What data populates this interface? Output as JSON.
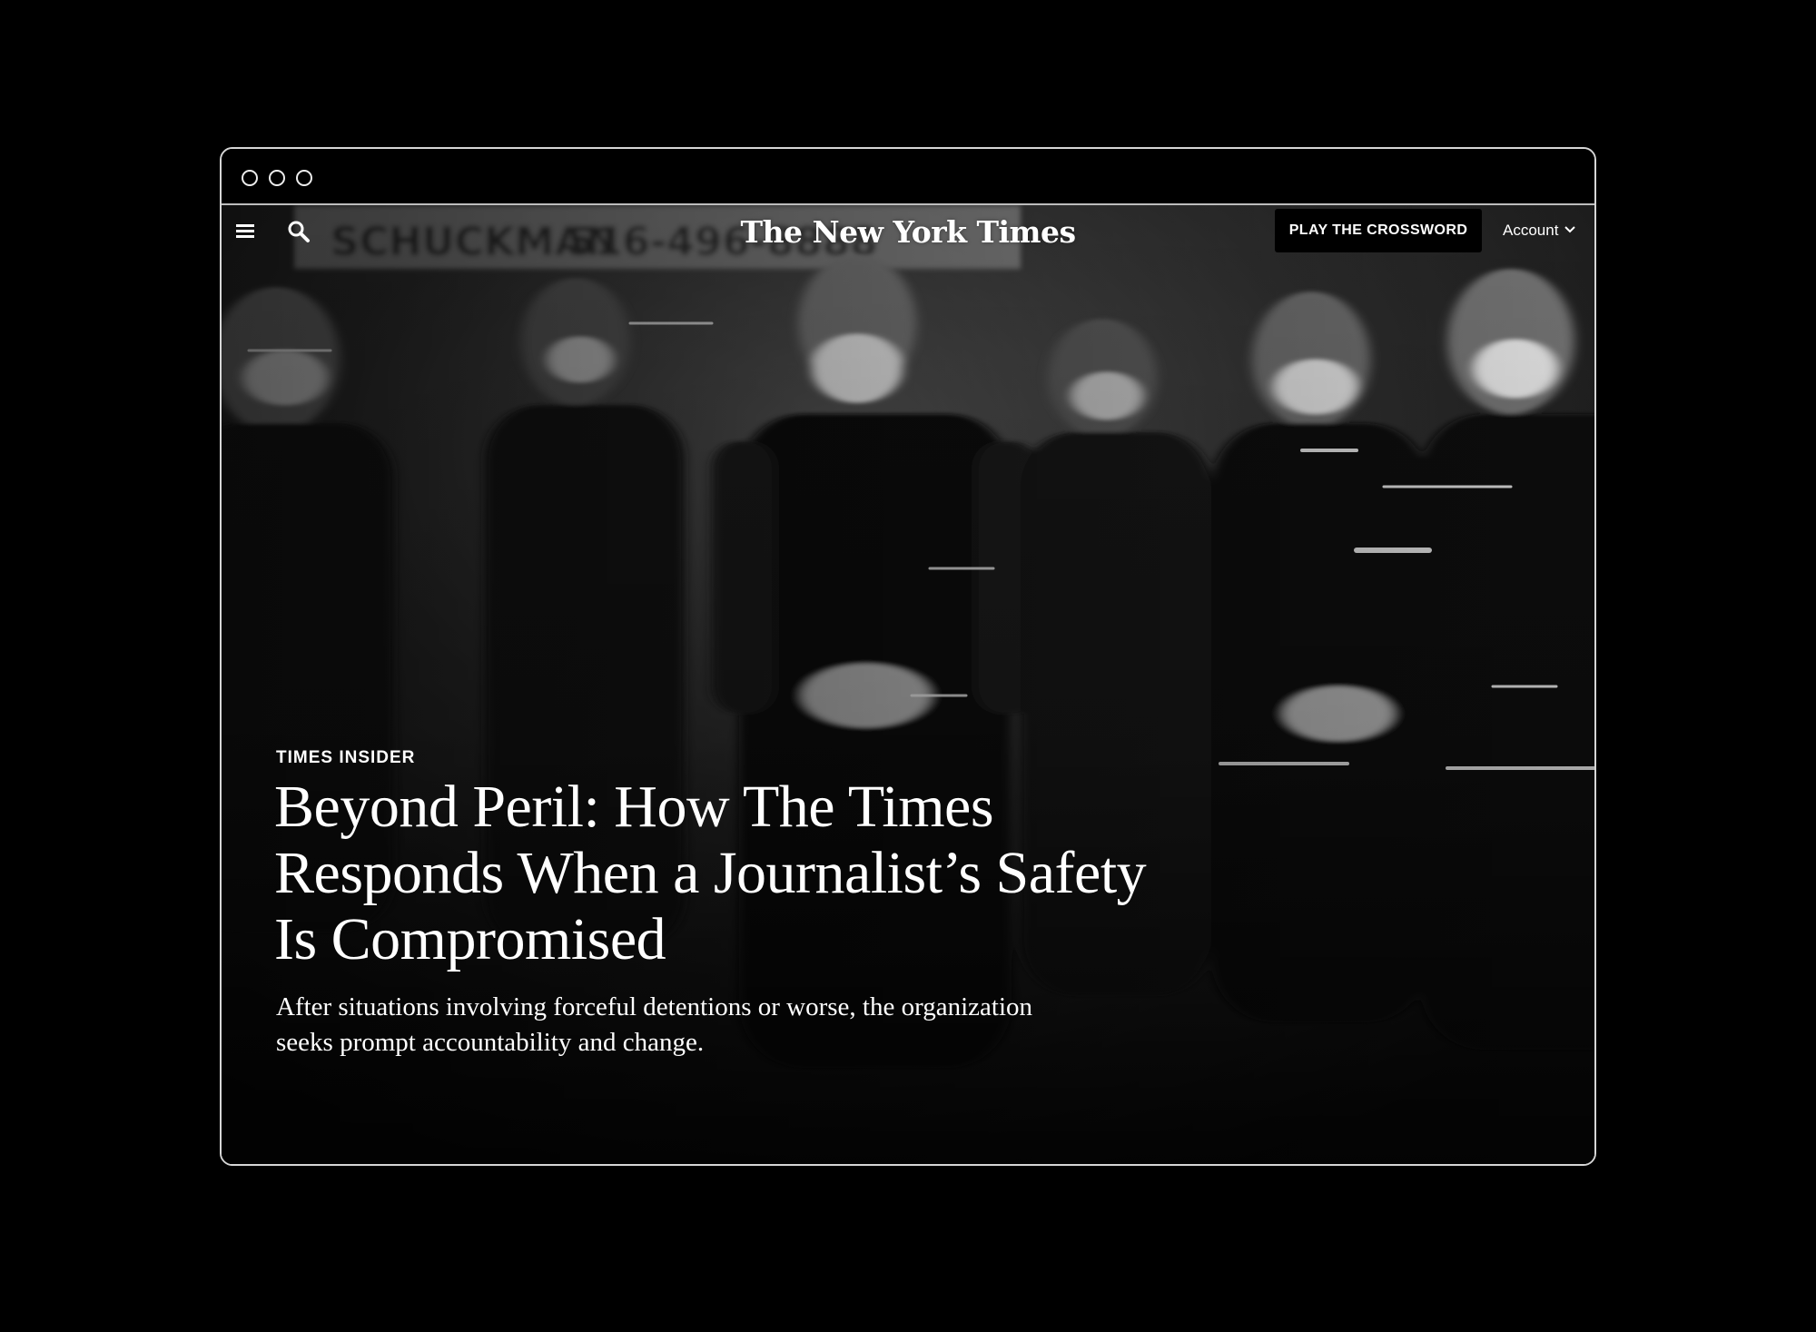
{
  "window": {
    "controls": [
      "close",
      "minimize",
      "maximize"
    ]
  },
  "nav": {
    "menu_icon": "hamburger-menu-icon",
    "search_icon": "search-icon",
    "logo": "The New York Times",
    "crossword_button": "PLAY THE CROSSWORD",
    "account_label": "Account",
    "account_icon": "chevron-down-icon"
  },
  "hero": {
    "image_description": "Black-and-white motion-blurred photo of masked police officers standing in a line at night",
    "background_sign": "516-496-8888"
  },
  "article": {
    "kicker": "TIMES INSIDER",
    "headline_line1": "Beyond Peril: How The Times",
    "headline_line2": "Responds When a Journalist’s Safety",
    "headline_line3": "Is Compromised",
    "summary_line1": "After situations involving forceful detentions or worse, the organization",
    "summary_line2": "seeks prompt accountability and change."
  },
  "colors": {
    "page_background": "#000000",
    "text": "#ffffff",
    "window_border": "#d6d6d6"
  }
}
